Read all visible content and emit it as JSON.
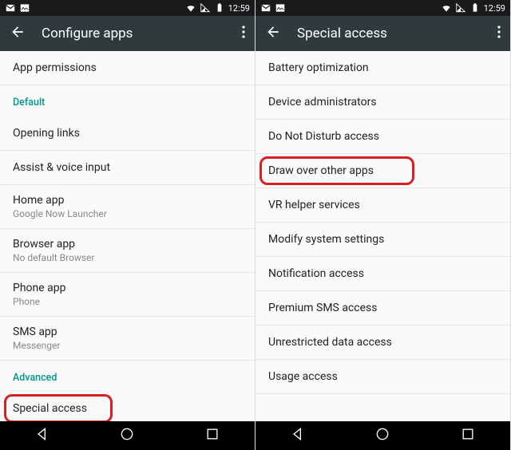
{
  "status": {
    "time": "12:59"
  },
  "left": {
    "title": "Configure apps",
    "items": [
      {
        "type": "item",
        "label": "App permissions"
      },
      {
        "type": "header",
        "label": "Default"
      },
      {
        "type": "item",
        "label": "Opening links"
      },
      {
        "type": "item",
        "label": "Assist & voice input"
      },
      {
        "type": "item2",
        "label": "Home app",
        "sub": "Google Now Launcher"
      },
      {
        "type": "item2",
        "label": "Browser app",
        "sub": "No default Browser"
      },
      {
        "type": "item2",
        "label": "Phone app",
        "sub": "Phone"
      },
      {
        "type": "item2",
        "label": "SMS app",
        "sub": "Messenger"
      },
      {
        "type": "header",
        "label": "Advanced"
      },
      {
        "type": "item",
        "label": "Special access",
        "highlight": true
      }
    ]
  },
  "right": {
    "title": "Special access",
    "items": [
      {
        "type": "item",
        "label": "Battery optimization"
      },
      {
        "type": "item",
        "label": "Device administrators"
      },
      {
        "type": "item",
        "label": "Do Not Disturb access"
      },
      {
        "type": "item",
        "label": "Draw over other apps",
        "highlight": true
      },
      {
        "type": "item",
        "label": "VR helper services"
      },
      {
        "type": "item",
        "label": "Modify system settings"
      },
      {
        "type": "item",
        "label": "Notification access"
      },
      {
        "type": "item",
        "label": "Premium SMS access"
      },
      {
        "type": "item",
        "label": "Unrestricted data access"
      },
      {
        "type": "item",
        "label": "Usage access"
      }
    ]
  }
}
